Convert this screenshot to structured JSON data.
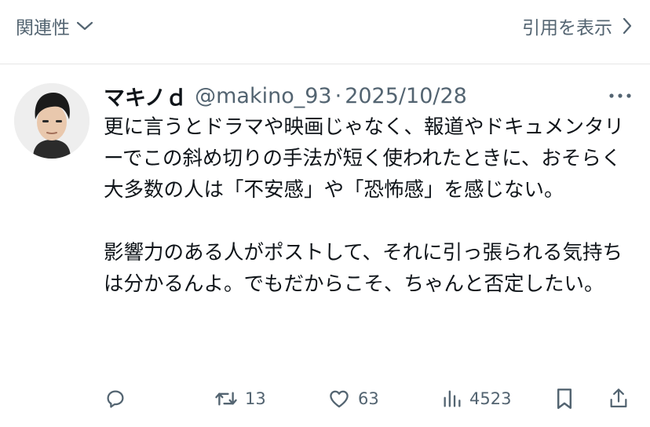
{
  "topbar": {
    "sort_label": "関連性",
    "sort_icon": "chevron-down-icon",
    "quotes_label": "引用を表示",
    "quotes_icon": "chevron-right-icon"
  },
  "post": {
    "author_name": "マキノｄ",
    "handle": "@makino_93",
    "separator": "·",
    "date": "2025/10/28",
    "more_icon": "more-horizontal-icon",
    "paragraphs": [
      "更に言うとドラマや映画じゃなく、報道やドキュメンタリーでこの斜め切りの手法が短く使われたときに、おそらく大多数の人は「不安感」や「恐怖感」を感じない。",
      "影響力のある人がポストして、それに引っ張られる気持ちは分かるんよ。でもだからこそ、ちゃんと否定したい。"
    ]
  },
  "actions": {
    "reply_icon": "reply-icon",
    "repost_icon": "repost-icon",
    "repost_count": "13",
    "like_icon": "heart-icon",
    "like_count": "63",
    "views_icon": "views-icon",
    "views_count": "4523",
    "bookmark_icon": "bookmark-icon",
    "share_icon": "share-icon"
  },
  "colors": {
    "text": "#0f1419",
    "secondary": "#536471",
    "divider": "#e6e6e6",
    "background": "#ffffff"
  }
}
